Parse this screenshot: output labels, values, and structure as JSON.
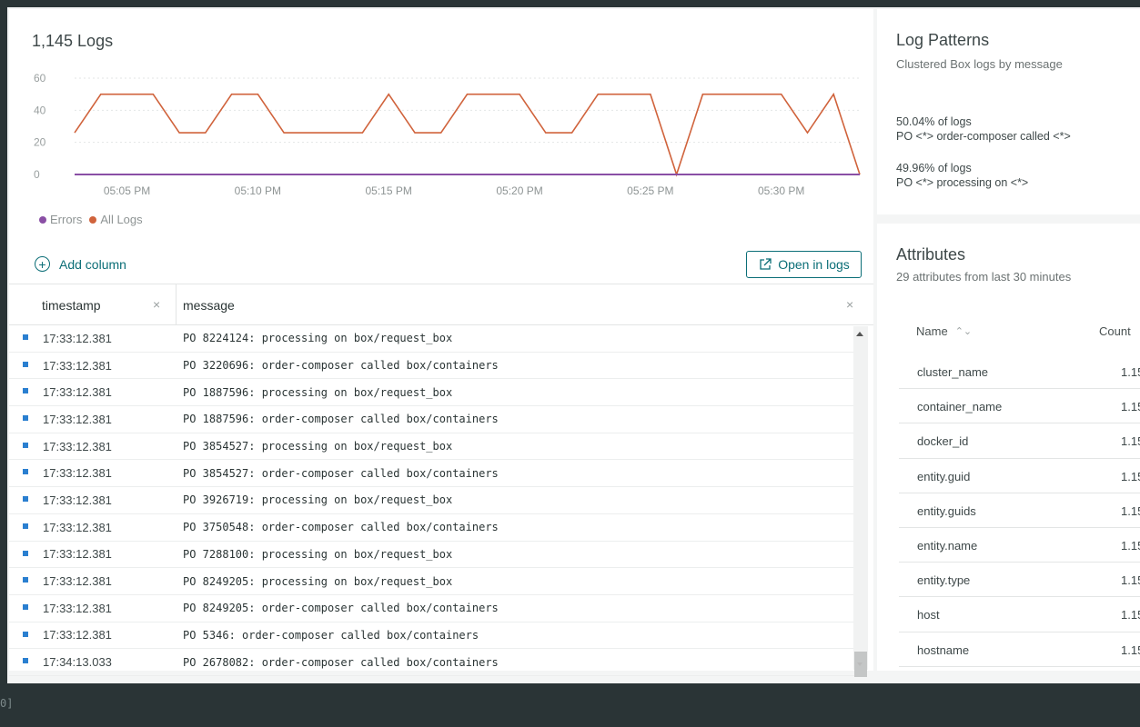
{
  "chart": {
    "title": "1,145 Logs",
    "y_ticks": [
      "60",
      "40",
      "20",
      "0"
    ],
    "x_ticks": [
      "05:05 PM",
      "05:10 PM",
      "05:15 PM",
      "05:20 PM",
      "05:25 PM",
      "05:30 PM"
    ],
    "legend": [
      {
        "label": "Errors",
        "color": "#8a4fa5"
      },
      {
        "label": "All Logs",
        "color": "#d0633c"
      }
    ]
  },
  "chart_data": {
    "type": "line",
    "title": "1,145 Logs",
    "ylim": [
      0,
      60
    ],
    "series": [
      {
        "name": "All Logs",
        "color": "#d0633c",
        "x": [
          "05:03:00",
          "05:04:00",
          "05:05:00",
          "05:06:00",
          "05:07:00",
          "05:08:00",
          "05:09:00",
          "05:10:00",
          "05:11:00",
          "05:12:00",
          "05:13:00",
          "05:14:00",
          "05:15:00",
          "05:16:00",
          "05:17:00",
          "05:18:00",
          "05:19:00",
          "05:20:00",
          "05:21:00",
          "05:22:00",
          "05:23:00",
          "05:24:00",
          "05:25:00",
          "05:26:00",
          "05:27:00",
          "05:28:00",
          "05:29:00",
          "05:30:00",
          "05:31:00",
          "05:32:00",
          "05:33:00"
        ],
        "values": [
          26,
          50,
          50,
          50,
          26,
          26,
          50,
          50,
          26,
          26,
          26,
          26,
          50,
          26,
          26,
          50,
          50,
          50,
          26,
          26,
          50,
          50,
          50,
          0,
          50,
          50,
          50,
          50,
          26,
          50,
          0
        ]
      },
      {
        "name": "Errors",
        "color": "#8a4fa5",
        "x": [
          "05:03:00",
          "05:33:00"
        ],
        "values": [
          0,
          0
        ]
      }
    ]
  },
  "toolbar": {
    "add_column": "Add column",
    "open_in_logs": "Open in logs"
  },
  "table": {
    "col_timestamp": "timestamp",
    "col_message": "message",
    "close": "×",
    "rows": [
      {
        "ts": "17:33:12.381",
        "msg": "PO 8224124: processing on box/request_box"
      },
      {
        "ts": "17:33:12.381",
        "msg": "PO 3220696: order-composer called box/containers"
      },
      {
        "ts": "17:33:12.381",
        "msg": "PO 1887596: processing on box/request_box"
      },
      {
        "ts": "17:33:12.381",
        "msg": "PO 1887596: order-composer called box/containers"
      },
      {
        "ts": "17:33:12.381",
        "msg": "PO 3854527: processing on box/request_box"
      },
      {
        "ts": "17:33:12.381",
        "msg": "PO 3854527: order-composer called box/containers"
      },
      {
        "ts": "17:33:12.381",
        "msg": "PO 3926719: processing on box/request_box"
      },
      {
        "ts": "17:33:12.381",
        "msg": "PO 3750548: order-composer called box/containers"
      },
      {
        "ts": "17:33:12.381",
        "msg": "PO 7288100: processing on box/request_box"
      },
      {
        "ts": "17:33:12.381",
        "msg": "PO 8249205: processing on box/request_box"
      },
      {
        "ts": "17:33:12.381",
        "msg": "PO 8249205: order-composer called box/containers"
      },
      {
        "ts": "17:33:12.381",
        "msg": "PO 5346: order-composer called box/containers"
      },
      {
        "ts": "17:34:13.033",
        "msg": "PO 2678082: order-composer called box/containers"
      }
    ]
  },
  "patterns": {
    "title": "Log Patterns",
    "subtitle": "Clustered Box logs by message",
    "items": [
      {
        "pct": "50.04% of logs",
        "text": "PO <*> order-composer called <*>"
      },
      {
        "pct": "49.96% of logs",
        "text": "PO <*> processing on <*>"
      }
    ]
  },
  "attributes": {
    "title": "Attributes",
    "subtitle": "29 attributes from last 30 minutes",
    "col_name": "Name",
    "col_count": "Count",
    "rows": [
      {
        "name": "cluster_name",
        "count": "1.15"
      },
      {
        "name": "container_name",
        "count": "1.15"
      },
      {
        "name": "docker_id",
        "count": "1.15"
      },
      {
        "name": "entity.guid",
        "count": "1.15"
      },
      {
        "name": "entity.guids",
        "count": "1.15"
      },
      {
        "name": "entity.name",
        "count": "1.15"
      },
      {
        "name": "entity.type",
        "count": "1.15"
      },
      {
        "name": "host",
        "count": "1.15"
      },
      {
        "name": "hostname",
        "count": "1.15"
      }
    ]
  },
  "console": {
    "text": "0]"
  }
}
